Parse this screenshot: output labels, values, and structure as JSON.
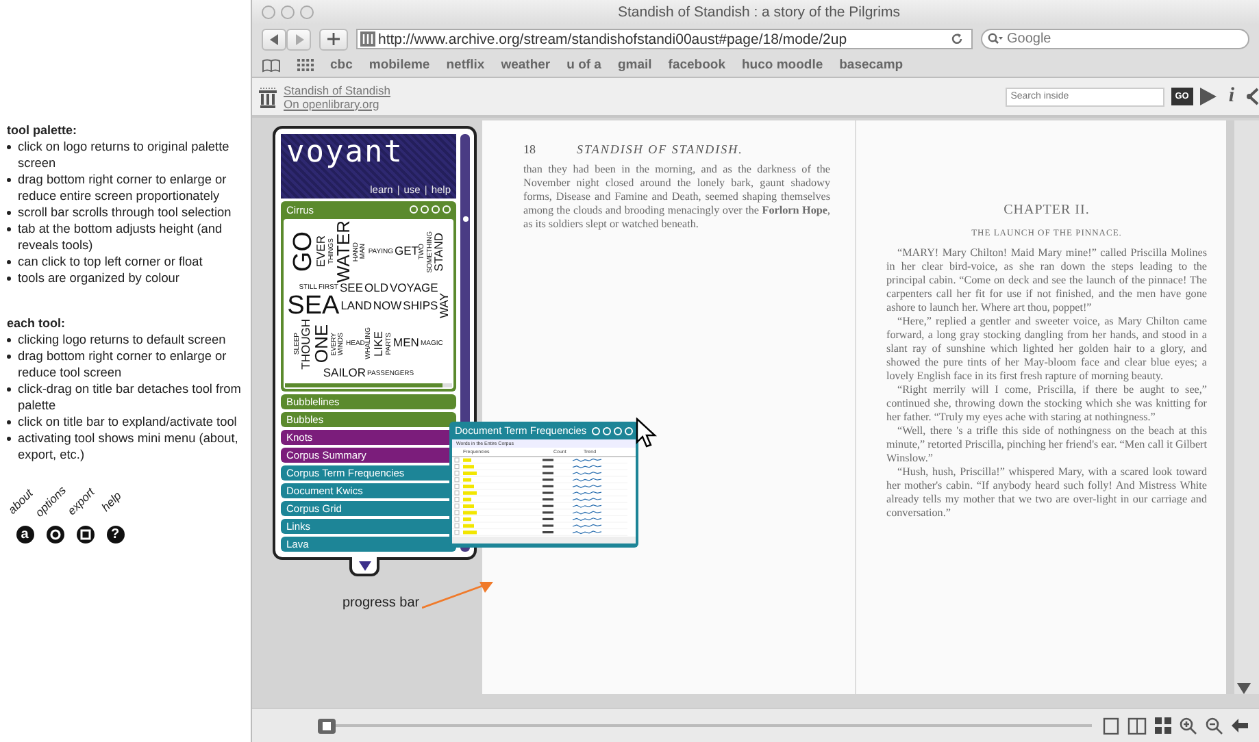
{
  "annotations": {
    "sections": [
      {
        "heading": "tool palette:",
        "items": [
          "click on logo returns to original palette screen",
          "drag bottom right corner to enlarge or reduce entire screen proportionately",
          "scroll bar scrolls through tool selection",
          "tab at the bottom adjusts height (and reveals tools)",
          "can click to top left corner or float",
          "tools are organized by colour"
        ]
      },
      {
        "heading": "each tool:",
        "items": [
          "clicking logo returns to default screen",
          "drag bottom right corner to enlarge or reduce tool screen",
          "click-drag on title bar detaches tool from palette",
          "click on title bar to expland/activate tool",
          "activating tool shows mini menu (about, export, etc.)"
        ]
      }
    ],
    "legend": [
      {
        "label": "about",
        "kind": "letter",
        "glyph": "a"
      },
      {
        "label": "options",
        "kind": "gear"
      },
      {
        "label": "export",
        "kind": "square"
      },
      {
        "label": "help",
        "kind": "letter",
        "glyph": "?"
      }
    ]
  },
  "window": {
    "title": "Standish of Standish : a story of the Pilgrims"
  },
  "toolbar": {
    "url": "http://www.archive.org/stream/standishofstandi00aust#page/18/mode/2up",
    "search_placeholder": "Google"
  },
  "bookmarks": [
    "cbc",
    "mobileme",
    "netflix",
    "weather",
    "u of a",
    "gmail",
    "facebook",
    "huco moodle",
    "basecamp"
  ],
  "archive_bar": {
    "link_lines": [
      "Standish of Standish",
      "On openlibrary.org"
    ],
    "search_placeholder": "Search inside",
    "go": "GO",
    "info": "i"
  },
  "book": {
    "left_page": {
      "number": "18",
      "running_head": "STANDISH OF STANDISH.",
      "paragraphs": [
        "than they had been in the morning, and as the darkness of the November night closed around the lonely bark, gaunt shadowy forms, Disease and Famine and Death, seemed shaping themselves among the clouds and brooding menacingly over the **Forlorn Hope**, as its soldiers slept or watched beneath."
      ]
    },
    "right_page": {
      "chapter": "CHAPTER II.",
      "subtitle": "THE LAUNCH OF THE PINNACE.",
      "paragraphs": [
        "“MARY! Mary Chilton! Maid Mary mine!” called Priscilla Molines in her clear bird-voice, as she ran down the steps leading to the principal cabin. “Come on deck and see the launch of the pinnace! The carpenters call her fit for use if not finished, and the men have gone ashore to launch her. Where art thou, poppet!”",
        "“Here,” replied a gentler and sweeter voice, as Mary Chilton came forward, a long gray stocking dangling from her hands, and stood in a slant ray of sunshine which lighted her golden hair to a glory, and showed the pure tints of her May-bloom face and clear blue eyes; a lovely English face in its first fresh rapture of morning beauty.",
        "“Right merrily will I come, Priscilla, if there be aught to see,” continued she, throwing down the stocking which she was knitting for her father. “Truly my eyes ache with staring at nothingness.”",
        "“Well, there 's a trifle this side of nothingness on the beach at this minute,” retorted Priscilla, pinching her friend's ear. “Men call it Gilbert Winslow.”",
        "“Hush, hush, Priscilla!” whispered Mary, with a scared look toward her mother's cabin. “If anybody heard such folly! And Mistress White already tells my mother that we two are over-light in our carriage and conversation.”"
      ]
    }
  },
  "palette": {
    "logo": "voyant",
    "links": [
      "learn",
      "use",
      "help"
    ],
    "link_separator": "|",
    "tools": [
      {
        "name": "Cirrus",
        "color": "#5b8a2d",
        "expanded": true
      },
      {
        "name": "Bubblelines",
        "color": "#5b8a2d",
        "expanded": false
      },
      {
        "name": "Bubbles",
        "color": "#5b8a2d",
        "expanded": false
      },
      {
        "name": "Knots",
        "color": "#7b1d7b",
        "expanded": false
      },
      {
        "name": "Corpus Summary",
        "color": "#7b1d7b",
        "expanded": false
      },
      {
        "name": "Corpus Term Frequencies",
        "color": "#1d8597",
        "expanded": false
      },
      {
        "name": "Document Kwics",
        "color": "#1d8597",
        "expanded": false
      },
      {
        "name": "Corpus Grid",
        "color": "#1d8597",
        "expanded": false
      },
      {
        "name": "Links",
        "color": "#1d8597",
        "expanded": false
      },
      {
        "name": "Lava",
        "color": "#1d8597",
        "expanded": false
      }
    ],
    "cloud_words": [
      {
        "text": "GO",
        "kind": "xl",
        "vertical": true
      },
      {
        "text": "EVER",
        "kind": "m",
        "vertical": true
      },
      {
        "text": "THINGS",
        "kind": "s",
        "vertical": true
      },
      {
        "text": "WATER",
        "kind": "l",
        "vertical": true
      },
      {
        "text": "HAND",
        "kind": "s",
        "vertical": true
      },
      {
        "text": "MAN",
        "kind": "s",
        "vertical": true
      },
      {
        "text": "PAYING",
        "kind": "s",
        "vertical": false
      },
      {
        "text": "GET",
        "kind": "m",
        "vertical": false
      },
      {
        "text": "TWO",
        "kind": "s",
        "vertical": true
      },
      {
        "text": "SOMETHING",
        "kind": "s",
        "vertical": true
      },
      {
        "text": "STAND",
        "kind": "m",
        "vertical": true
      },
      {
        "text": "STILL",
        "kind": "s",
        "vertical": false
      },
      {
        "text": "FIRST",
        "kind": "s",
        "vertical": false
      },
      {
        "text": "SEE",
        "kind": "m",
        "vertical": false
      },
      {
        "text": "OLD",
        "kind": "m",
        "vertical": false
      },
      {
        "text": "VOYAGE",
        "kind": "m",
        "vertical": false
      },
      {
        "text": "SEA",
        "kind": "xl",
        "vertical": false
      },
      {
        "text": "LAND",
        "kind": "m",
        "vertical": false
      },
      {
        "text": "NOW",
        "kind": "m",
        "vertical": false
      },
      {
        "text": "SHIPS",
        "kind": "m",
        "vertical": false
      },
      {
        "text": "WAY",
        "kind": "m",
        "vertical": true
      },
      {
        "text": "SLEEP",
        "kind": "s",
        "vertical": true
      },
      {
        "text": "THOUGH",
        "kind": "m",
        "vertical": true
      },
      {
        "text": "ONE",
        "kind": "l",
        "vertical": true
      },
      {
        "text": "EVERY",
        "kind": "s",
        "vertical": true
      },
      {
        "text": "WINDS",
        "kind": "s",
        "vertical": true
      },
      {
        "text": "HEAD",
        "kind": "s",
        "vertical": false
      },
      {
        "text": "WHALING",
        "kind": "s",
        "vertical": true
      },
      {
        "text": "LIKE",
        "kind": "m",
        "vertical": true
      },
      {
        "text": "PARTS",
        "kind": "s",
        "vertical": true
      },
      {
        "text": "MEN",
        "kind": "m",
        "vertical": false
      },
      {
        "text": "MAGIC",
        "kind": "s",
        "vertical": false
      },
      {
        "text": "SAILOR",
        "kind": "m",
        "vertical": false
      },
      {
        "text": "PASSENGERS",
        "kind": "s",
        "vertical": false
      }
    ]
  },
  "cloud_progress": {
    "level": 0.94
  },
  "page_slider": {
    "level": 0.0
  },
  "dtf_window": {
    "title": "Document Term Frequencies",
    "caption": "Words in the Entire Corpus",
    "columns": [
      "Frequencies",
      "Count",
      "Trend"
    ]
  },
  "callout": {
    "label": "progress bar"
  }
}
